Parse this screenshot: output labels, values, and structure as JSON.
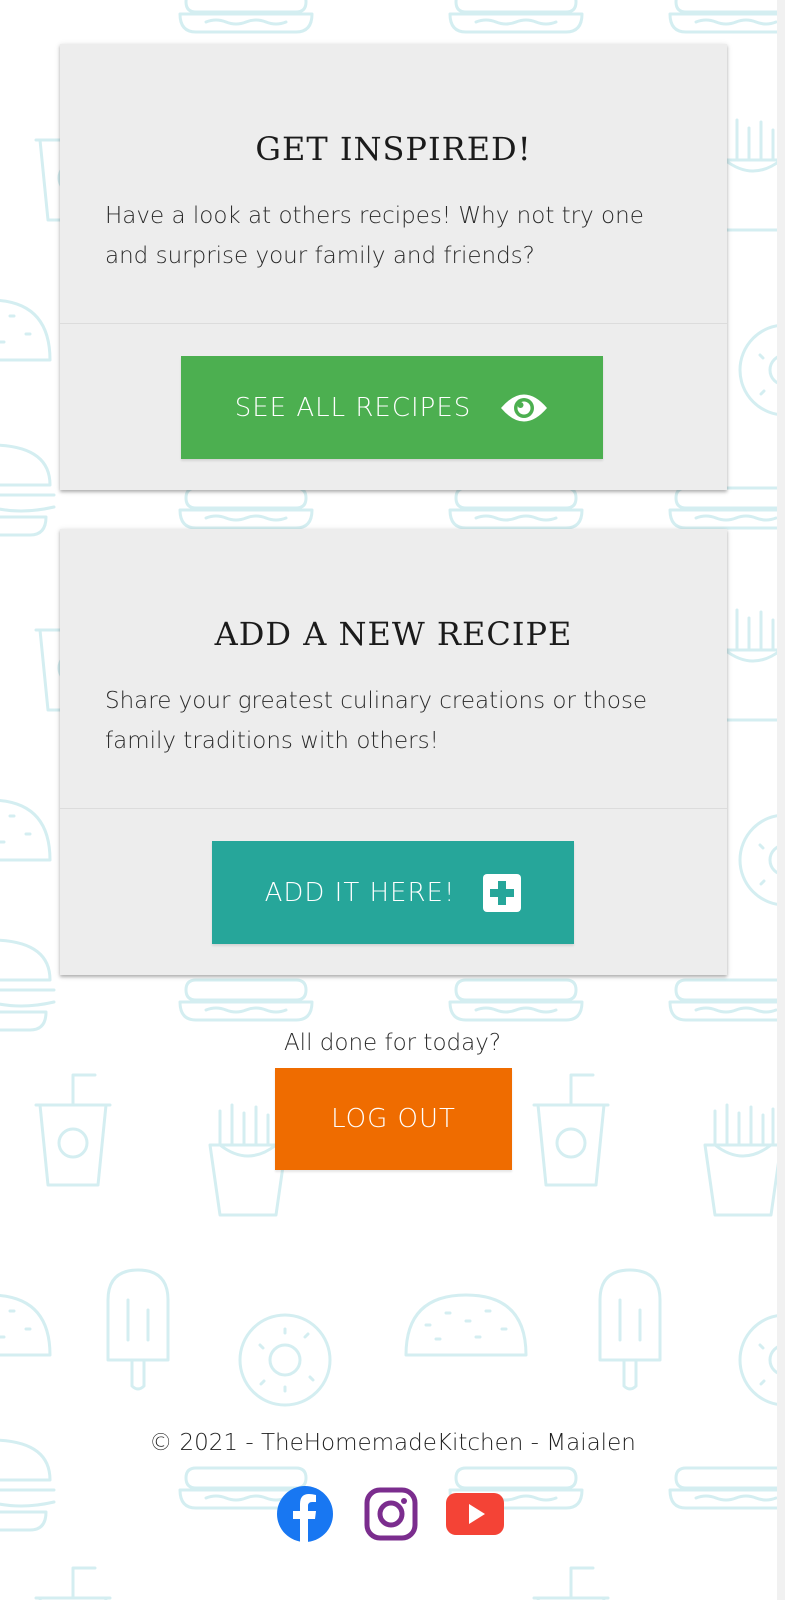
{
  "cards": [
    {
      "title": "GET INSPIRED!",
      "text": "Have a look at others recipes! Why not try one and surprise your family and friends?",
      "button": {
        "label": "SEE ALL RECIPES",
        "icon": "eye-icon",
        "color": "#4caf50"
      }
    },
    {
      "title": "ADD A NEW RECIPE",
      "text": "Share your greatest culinary creations or those family traditions with others!",
      "button": {
        "label": "ADD IT HERE!",
        "icon": "plus-square-icon",
        "color": "#26a69a"
      }
    }
  ],
  "logout": {
    "prompt": "All done for today?",
    "label": "LOG OUT",
    "color": "#ef6c00"
  },
  "footer": {
    "copyright": "© 2021 - TheHomemadeKitchen - Maialen",
    "social": [
      {
        "name": "facebook",
        "icon": "facebook-icon",
        "color": "#1877f2"
      },
      {
        "name": "instagram",
        "icon": "instagram-icon",
        "color": "#7b2d8e"
      },
      {
        "name": "youtube",
        "icon": "youtube-icon",
        "color": "#f44336"
      }
    ]
  },
  "theme": {
    "card_background": "#ededed",
    "pattern_color": "#d4eef1"
  }
}
